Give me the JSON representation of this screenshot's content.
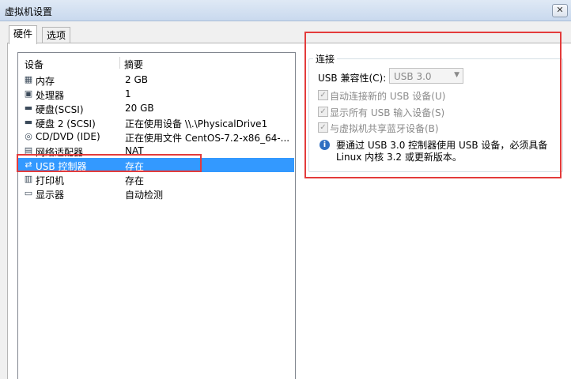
{
  "window": {
    "title": "虚拟机设置",
    "close_glyph": "✕"
  },
  "tabs": [
    {
      "label": "硬件",
      "active": true
    },
    {
      "label": "选项",
      "active": false
    }
  ],
  "device_list": {
    "columns": [
      "设备",
      "摘要"
    ],
    "rows": [
      {
        "icon": "memory-icon",
        "glyph": "▦",
        "name": "内存",
        "summary": "2 GB"
      },
      {
        "icon": "cpu-icon",
        "glyph": "▣",
        "name": "处理器",
        "summary": "1"
      },
      {
        "icon": "hard-disk-icon",
        "glyph": "▬",
        "name": "硬盘(SCSI)",
        "summary": "20 GB"
      },
      {
        "icon": "hard-disk-icon",
        "glyph": "▬",
        "name": "硬盘 2 (SCSI)",
        "summary": "正在使用设备 \\\\.\\PhysicalDrive1"
      },
      {
        "icon": "cd-dvd-icon",
        "glyph": "◎",
        "name": "CD/DVD (IDE)",
        "summary": "正在使用文件 CentOS-7.2-x86_64-..."
      },
      {
        "icon": "network-adapter-icon",
        "glyph": "▤",
        "name": "网络适配器",
        "summary": "NAT"
      },
      {
        "icon": "usb-icon",
        "glyph": "⇄",
        "name": "USB 控制器",
        "summary": "存在",
        "selected": true
      },
      {
        "icon": "printer-icon",
        "glyph": "▥",
        "name": "打印机",
        "summary": "存在"
      },
      {
        "icon": "monitor-icon",
        "glyph": "▭",
        "name": "显示器",
        "summary": "自动检测"
      }
    ]
  },
  "connection": {
    "legend": "连接",
    "compat_label": "USB 兼容性(C):",
    "compat_value": "USB 3.0",
    "checkboxes": [
      {
        "label": "自动连接新的 USB 设备(U)",
        "checked": true,
        "disabled": true
      },
      {
        "label": "显示所有 USB 输入设备(S)",
        "checked": true,
        "disabled": true
      },
      {
        "label": "与虚拟机共享蓝牙设备(B)",
        "checked": true,
        "disabled": true
      }
    ],
    "info_text": "要通过 USB 3.0 控制器使用 USB 设备，必须具备 Linux 内核 3.2 或更新版本。"
  },
  "colors": {
    "selection": "#3399ff",
    "highlight_box": "#e33b3b",
    "info_icon": "#2f6fc2"
  }
}
